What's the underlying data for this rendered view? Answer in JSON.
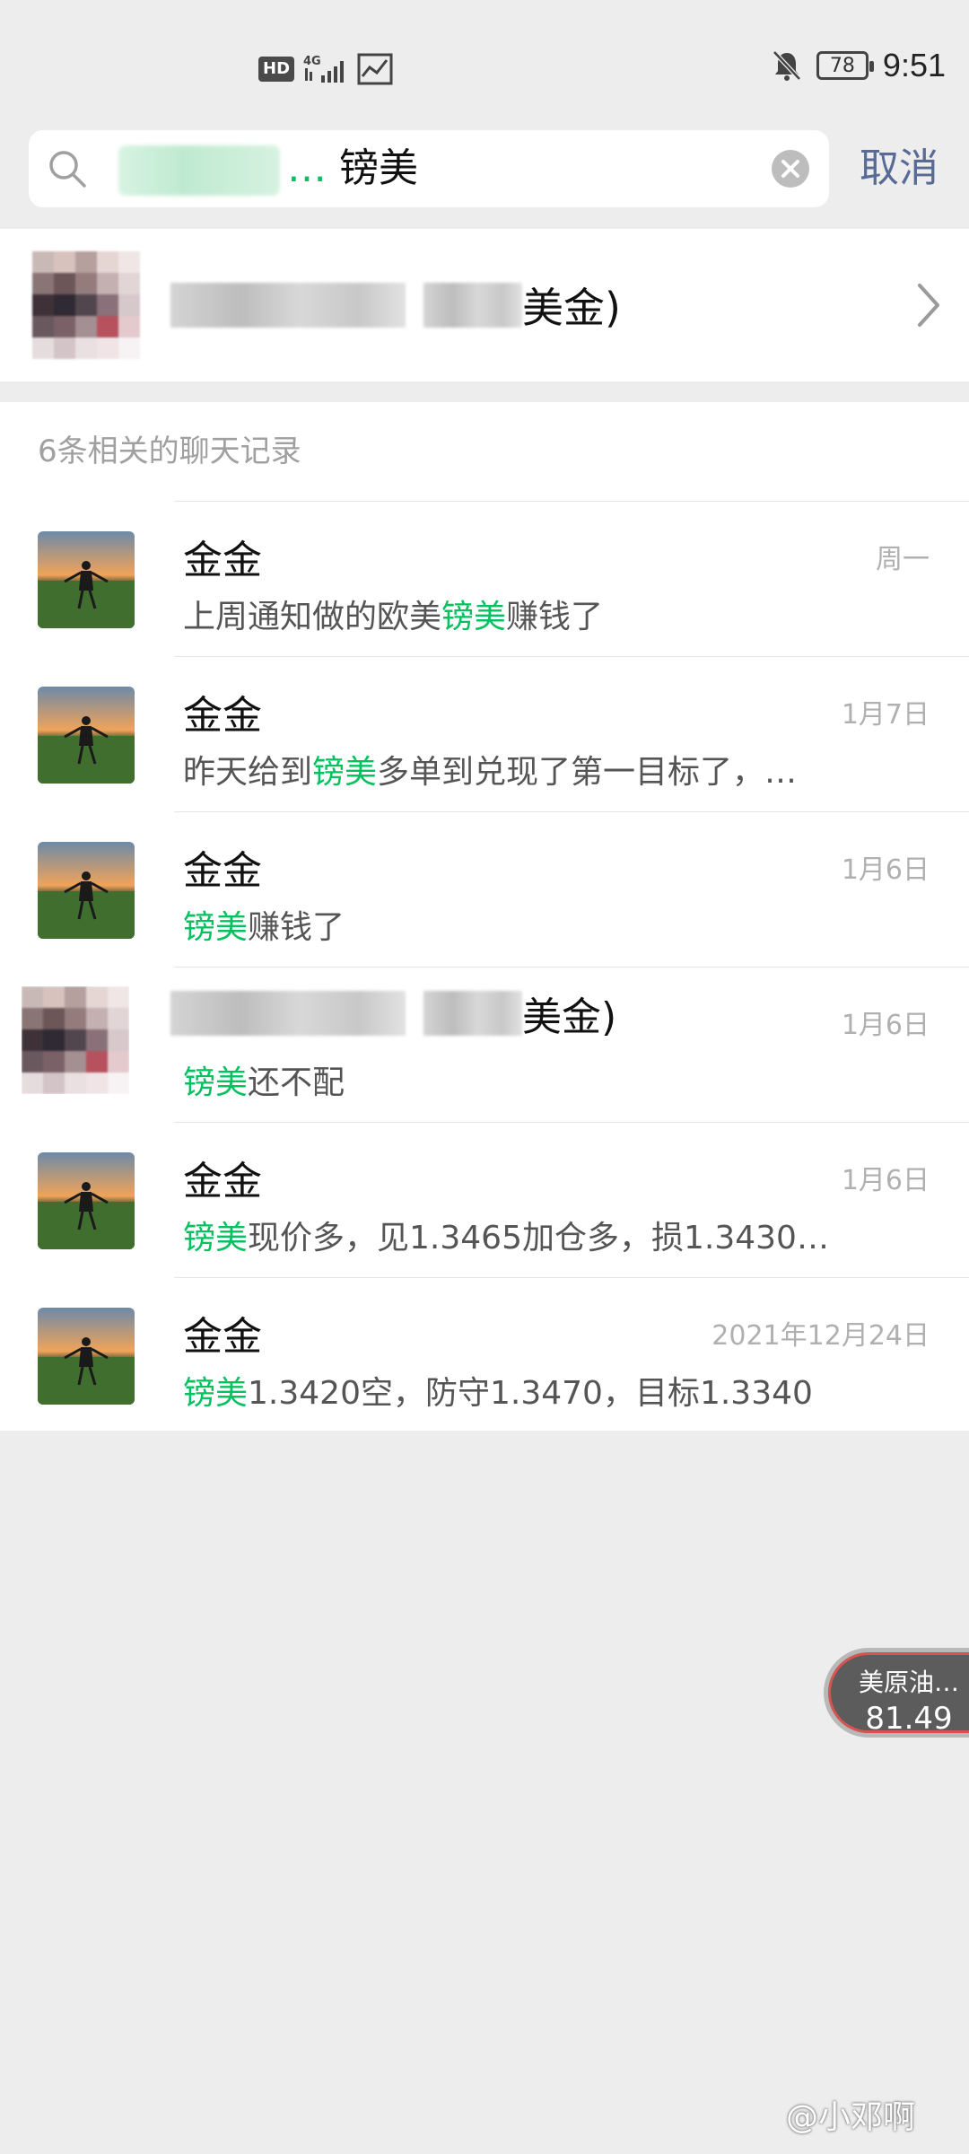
{
  "status_bar": {
    "hd": "HD",
    "network": "4G",
    "battery": "78",
    "time": "9:51",
    "icons": [
      "hd-icon",
      "signal-icon",
      "chart-icon",
      "mute-bell-icon",
      "battery-icon"
    ]
  },
  "search": {
    "highlight_dots": "…",
    "query": " 镑美",
    "cancel_label": "取消"
  },
  "contact": {
    "name_suffix": "美金)"
  },
  "records": {
    "header": "6条相关的聊天记录",
    "items": [
      {
        "name": "金金",
        "date": "周一",
        "pre": "上周通知做的欧美",
        "hl": "镑美",
        "post": "赚钱了"
      },
      {
        "name": "金金",
        "date": "1月7日",
        "pre": "昨天给到",
        "hl": "镑美",
        "post": "多单到兑现了第一目标了，…"
      },
      {
        "name": "金金",
        "date": "1月6日",
        "pre": "",
        "hl": "镑美",
        "post": "赚钱了"
      },
      {
        "name": "美金)",
        "date": "1月6日",
        "pre": "",
        "hl": "镑美",
        "post": "还不配"
      },
      {
        "name": "金金",
        "date": "1月6日",
        "pre": "",
        "hl": "镑美",
        "post": "现价多，见1.3465加仓多，损1.3430…"
      },
      {
        "name": "金金",
        "date": "2021年12月24日",
        "pre": "",
        "hl": "镑美",
        "post": "1.3420空，防守1.3470，目标1.3340"
      }
    ]
  },
  "widget": {
    "label": "美原油…",
    "value": "81.49"
  },
  "watermark": "@小邓啊",
  "colors": {
    "highlight": "#07c160",
    "link": "#576b95",
    "background": "#ededed"
  }
}
